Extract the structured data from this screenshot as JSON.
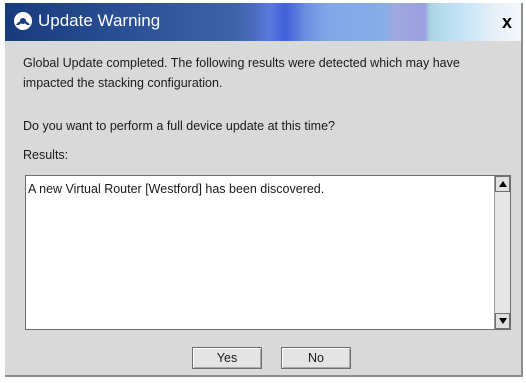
{
  "window": {
    "title": "Update Warning",
    "close_label": "x",
    "logo_icon": "circular-logo-icon"
  },
  "message": {
    "line1": "Global Update completed. The following results were detected which may have impacted the stacking configuration.",
    "question": "Do you want to perform a full device update at this time?",
    "results_label": "Results:"
  },
  "results": {
    "text": "A new Virtual Router [Westford] has been discovered."
  },
  "buttons": {
    "yes_label": "Yes",
    "no_label": "No"
  },
  "colors": {
    "titlebar_start": "#173b7c",
    "titlebar_end": "#f4f6fa",
    "dialog_bg": "#d9d9d9"
  }
}
